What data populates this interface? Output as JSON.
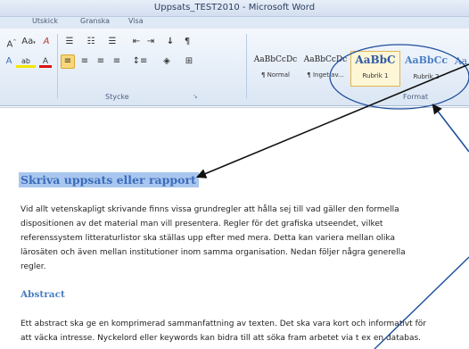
{
  "window": {
    "title": "Uppsats_TEST2010 - Microsoft Word"
  },
  "ribbon": {
    "tabs": [
      "Utskick",
      "Granska",
      "Visa"
    ],
    "groups": {
      "paragraph_label": "Stycke",
      "styles_label": "Format"
    },
    "font_controls": {
      "size_letter": "A",
      "change_case": "Aa",
      "clear_label": "A",
      "highlight_label": "ab",
      "font_color_label": "A"
    },
    "styles": [
      {
        "sample": "AaBbCcDc",
        "name": "¶ Normal"
      },
      {
        "sample": "AaBbCcDc",
        "name": "¶ Inget av..."
      },
      {
        "sample": "AaBbC",
        "name": "Rubrik 1"
      },
      {
        "sample": "AaBbCc",
        "name": "Rubrik 2"
      },
      {
        "sample": "Aa",
        "name": ""
      }
    ]
  },
  "document": {
    "heading1": "Skriva uppsats eller rapport",
    "para1": [
      "Vid allt vetenskapligt skrivande finns vissa grundregler att hålla sej till vad gäller den formella",
      "dispositionen av det material man vill presentera. Regler för det grafiska utseendet, vilket",
      "referenssystem litteraturlistor ska ställas upp efter med mera. Detta kan variera mellan olika",
      "lärosäten och även mellan institutioner inom samma organisation. Nedan följer några generella",
      "regler."
    ],
    "heading2": "Abstract",
    "para2": [
      "Ett abstract ska ge en komprimerad sammanfattning av texten. Det ska vara kort och informativt för",
      "att väcka intresse. Nyckelord eller keywords kan bidra till att söka fram arbetet via t ex en databas."
    ]
  },
  "colors": {
    "accent": "#1e4f9c",
    "heading": "#3b6dbb",
    "highlight": "#a9c6ee",
    "selected_style": "#fff6d6"
  }
}
